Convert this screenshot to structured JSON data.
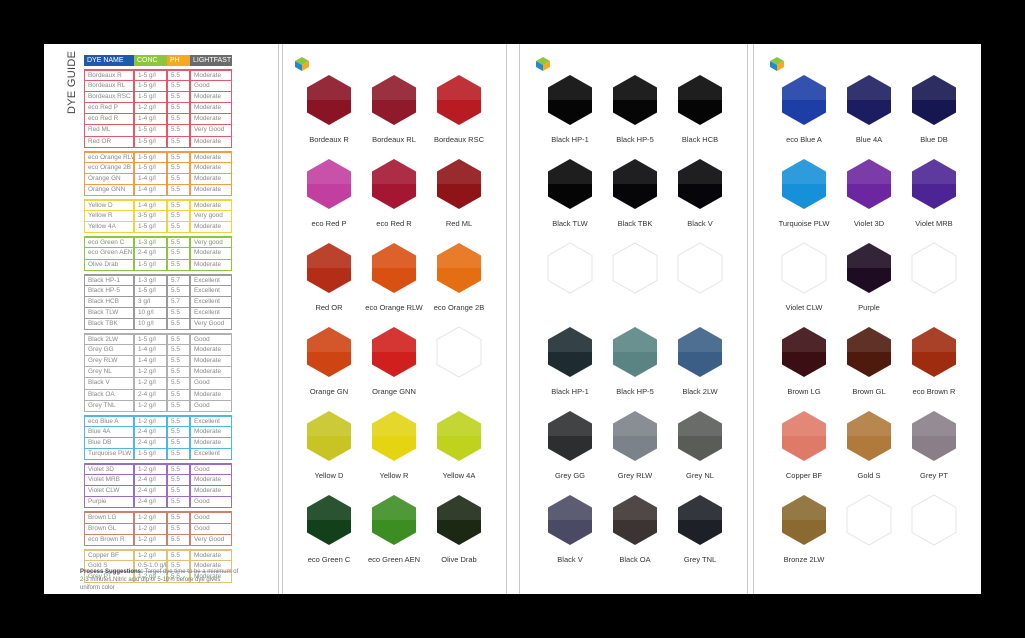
{
  "guide": {
    "title": "DYE GUIDE",
    "headers": [
      {
        "label": "DYE NAME",
        "color": "#1f5aa8"
      },
      {
        "label": "CONC",
        "color": "#8cc63f"
      },
      {
        "label": "PH",
        "color": "#f7a823"
      },
      {
        "label": "LIGHTFAST",
        "color": "#6b6b6b"
      }
    ],
    "groups": [
      {
        "color": "#e25a6a",
        "rows": [
          [
            "Bordeaux R",
            "1-5 g/l",
            "5.5",
            "Moderate"
          ],
          [
            "Bordeaux RL",
            "1-5 g/l",
            "5.5",
            "Good"
          ],
          [
            "Bordeaux RSC",
            "1-5 g/l",
            "5.5",
            "Moderate"
          ],
          [
            "eco Red P",
            "1-2 g/l",
            "5.5",
            "Moderate"
          ],
          [
            "eco Red R",
            "1-4 g/l",
            "5.5",
            "Moderate"
          ],
          [
            "Red ML",
            "1-5 g/l",
            "5.5",
            "Very Good"
          ],
          [
            "Red OR",
            "1-5 g/l",
            "5.5",
            "Moderate"
          ]
        ]
      },
      {
        "color": "#f39b44",
        "rows": [
          [
            "eco Orange RLW",
            "1-5 g/l",
            "5.5",
            "Moderate"
          ],
          [
            "eco Orange 2B",
            "1-5 g/l",
            "5.5",
            "Moderate"
          ],
          [
            "Orange GN",
            "1-4 g/l",
            "5.5",
            "Moderate"
          ],
          [
            "Orange GNN",
            "1-4 g/l",
            "5.5",
            "Moderate"
          ]
        ]
      },
      {
        "color": "#f2d33c",
        "rows": [
          [
            "Yellow D",
            "1-4 g/l",
            "5.5",
            "Moderate"
          ],
          [
            "Yellow R",
            "3-5 g/l",
            "5.5",
            "Very good"
          ],
          [
            "Yellow 4A",
            "1-5 g/l",
            "5.5",
            "Moderate"
          ]
        ]
      },
      {
        "color": "#8cc63f",
        "rows": [
          [
            "eco Green C",
            "1-3 g/l",
            "5.5",
            "Very good"
          ],
          [
            "eco Green AEN",
            "2-4 g/l",
            "5.5",
            "Moderate"
          ],
          [
            "Olive Drab",
            "1-5 g/l",
            "5.5",
            "Moderate"
          ]
        ]
      },
      {
        "color": "#9a9a9a",
        "rows": [
          [
            "Black HP-1",
            "1-3 g/l",
            "5.7",
            "Excellent"
          ],
          [
            "Black HP-5",
            "1-5 g/l",
            "5.5",
            "Excellent"
          ],
          [
            "Black HCB",
            "3 g/l",
            "5.7",
            "Excellent"
          ],
          [
            "Black TLW",
            "10 g/l",
            "5.5",
            "Excellent"
          ],
          [
            "Black TBK",
            "10 g/l",
            "5.5",
            "Very Good"
          ]
        ]
      },
      {
        "color": "#b0b0b0",
        "rows": [
          [
            "Black 2LW",
            "1-5 g/l",
            "5.5",
            "Good"
          ],
          [
            "Grey GG",
            "1-4 g/l",
            "5.5",
            "Moderate"
          ],
          [
            "Grey RLW",
            "1-4 g/l",
            "5.5",
            "Moderate"
          ],
          [
            "Grey NL",
            "1-2 g/l",
            "5.5",
            "Moderate"
          ],
          [
            "Black V",
            "1-2 g/l",
            "5.5",
            "Good"
          ],
          [
            "Black OA",
            "2-4 g/l",
            "5.5",
            "Moderate"
          ],
          [
            "Grey TNL",
            "1-2 g/l",
            "5.5",
            "Good"
          ]
        ]
      },
      {
        "color": "#4fb6e6",
        "rows": [
          [
            "eco Blue A",
            "1-2 g/l",
            "5.5",
            "Excellent"
          ],
          [
            "Blue 4A",
            "2-4 g/l",
            "5.5",
            "Moderate"
          ],
          [
            "Blue DB",
            "2-4 g/l",
            "5.5",
            "Moderate"
          ],
          [
            "Turquoise PLW",
            "1-5 g/l",
            "5.5",
            "Excellent"
          ]
        ]
      },
      {
        "color": "#9b6cc4",
        "rows": [
          [
            "Violet 3D",
            "1-2 g/l",
            "5.5",
            "Good"
          ],
          [
            "Violet MRB",
            "2-4 g/l",
            "5.5",
            "Moderate"
          ],
          [
            "Violet CLW",
            "2-4 g/l",
            "5.5",
            "Moderate"
          ],
          [
            "Purple",
            "2-4 g/l",
            "5.5",
            "Good"
          ]
        ]
      },
      {
        "color": "#c9826b",
        "rows": [
          [
            "Brown LG",
            "1-2 g/l",
            "5.5",
            "Good"
          ],
          [
            "Brown GL",
            "1-2 g/l",
            "5.5",
            "Good"
          ],
          [
            "eco Brown R",
            "1-2 g/l",
            "5.5",
            "Very Good"
          ]
        ]
      },
      {
        "color": "#e2c07a",
        "rows": [
          [
            "Copper BF",
            "1-2 g/l",
            "5.5",
            "Moderate"
          ],
          [
            "Gold S",
            "0.5-1.0 g/l",
            "5.5",
            "Moderate"
          ],
          [
            "Grey PT",
            "1-2 g/l",
            "5.5",
            "Moderate"
          ]
        ]
      }
    ],
    "notes_label": "Process Suggestions:",
    "notes_text": "Target dye time to be a minimum of 2-3 minutes.Nitric acid dip of 5-10% before dye gives uniform color"
  },
  "panels": [
    {
      "swatches": [
        {
          "label": "Bordeaux R",
          "color": "#8a1424"
        },
        {
          "label": "Bordeaux RL",
          "color": "#8e1a2a"
        },
        {
          "label": "Bordeaux RSC",
          "color": "#b81c22"
        },
        {
          "label": "eco Red P",
          "color": "#c23fa0"
        },
        {
          "label": "eco Red R",
          "color": "#a41632"
        },
        {
          "label": "Red ML",
          "color": "#8e1418"
        },
        {
          "label": "Red OR",
          "color": "#b42d16"
        },
        {
          "label": "eco Orange RLW",
          "color": "#d85012"
        },
        {
          "label": "eco Orange 2B",
          "color": "#e66e12"
        },
        {
          "label": "Orange GN",
          "color": "#ce4412"
        },
        {
          "label": "Orange GNN",
          "color": "#d0201e"
        },
        {
          "label": "",
          "color": ""
        },
        {
          "label": "Yellow D",
          "color": "#c8c424"
        },
        {
          "label": "Yellow R",
          "color": "#e4d412"
        },
        {
          "label": "Yellow 4A",
          "color": "#bed21e"
        },
        {
          "label": "eco Green C",
          "color": "#12401a"
        },
        {
          "label": "eco Green AEN",
          "color": "#3c8e22"
        },
        {
          "label": "Olive Drab",
          "color": "#1c2814"
        }
      ]
    },
    {
      "swatches": [
        {
          "label": "Black HP-1",
          "color": "#050505"
        },
        {
          "label": "Black HP-5",
          "color": "#060606"
        },
        {
          "label": "Black HCB",
          "color": "#050505"
        },
        {
          "label": "Black TLW",
          "color": "#050505"
        },
        {
          "label": "Black TBK",
          "color": "#060608"
        },
        {
          "label": "Black V",
          "color": "#06060a"
        },
        {
          "label": "",
          "color": ""
        },
        {
          "label": "",
          "color": ""
        },
        {
          "label": "",
          "color": ""
        },
        {
          "label": "Black HP-1",
          "color": "#1e2c32"
        },
        {
          "label": "Black HP-5",
          "color": "#5a8484"
        },
        {
          "label": "Black 2LW",
          "color": "#3a5e86"
        },
        {
          "label": "Grey GG",
          "color": "#2c2e30"
        },
        {
          "label": "Grey RLW",
          "color": "#7c828a"
        },
        {
          "label": "Grey NL",
          "color": "#5a5c58"
        },
        {
          "label": "Black V",
          "color": "#4a4a64"
        },
        {
          "label": "Black OA",
          "color": "#3c3432"
        },
        {
          "label": "Grey TNL",
          "color": "#1e2028"
        }
      ]
    },
    {
      "swatches": [
        {
          "label": "eco Blue A",
          "color": "#1c3ea6"
        },
        {
          "label": "Blue 4A",
          "color": "#1c1c60"
        },
        {
          "label": "Blue DB",
          "color": "#161650"
        },
        {
          "label": "Turquoise PLW",
          "color": "#1690d8"
        },
        {
          "label": "Violet 3D",
          "color": "#6c26a0"
        },
        {
          "label": "Violet MRB",
          "color": "#4c2494"
        },
        {
          "label": "Violet CLW",
          "color": ""
        },
        {
          "label": "Purple",
          "color": "#1e0c22"
        },
        {
          "label": "",
          "color": ""
        },
        {
          "label": "Brown LG",
          "color": "#3a0e12"
        },
        {
          "label": "Brown GL",
          "color": "#4e1a0e"
        },
        {
          "label": "eco Brown R",
          "color": "#a02c10"
        },
        {
          "label": "Copper BF",
          "color": "#e07a68"
        },
        {
          "label": "Gold S",
          "color": "#b07a3c"
        },
        {
          "label": "Grey PT",
          "color": "#8a7e88"
        },
        {
          "label": "Bronze 2LW",
          "color": "#8a6a30"
        },
        {
          "label": "",
          "color": ""
        },
        {
          "label": "",
          "color": ""
        }
      ]
    }
  ]
}
